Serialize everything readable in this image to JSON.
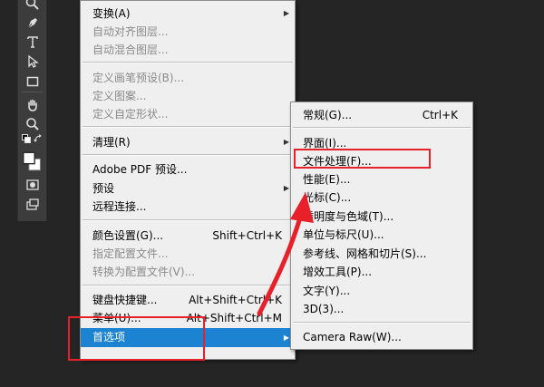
{
  "toolbar": {
    "tools": [
      "zoom-icon",
      "pen-icon",
      "type-icon",
      "path-select-icon",
      "rectangle-icon",
      "hand-icon",
      "zoom-icon",
      "default-colors-icon",
      "swap-colors-icon",
      "color-swatches",
      "quick-mask-icon",
      "screen-mode-icon"
    ]
  },
  "edit_menu": {
    "items": [
      {
        "label": "变换(A)",
        "shortcut": "",
        "submenu": true,
        "disabled": false
      },
      {
        "label": "自动对齐图层...",
        "shortcut": "",
        "submenu": false,
        "disabled": true
      },
      {
        "label": "自动混合图层...",
        "shortcut": "",
        "submenu": false,
        "disabled": true
      },
      {
        "label": "定义画笔预设(B)...",
        "shortcut": "",
        "submenu": false,
        "disabled": true
      },
      {
        "label": "定义图案...",
        "shortcut": "",
        "submenu": false,
        "disabled": true
      },
      {
        "label": "定义自定形状...",
        "shortcut": "",
        "submenu": false,
        "disabled": true
      },
      {
        "label": "清理(R)",
        "shortcut": "",
        "submenu": true,
        "disabled": false
      },
      {
        "label": "Adobe PDF 预设...",
        "shortcut": "",
        "submenu": false,
        "disabled": false
      },
      {
        "label": "预设",
        "shortcut": "",
        "submenu": true,
        "disabled": false
      },
      {
        "label": "远程连接...",
        "shortcut": "",
        "submenu": false,
        "disabled": false
      },
      {
        "label": "颜色设置(G)...",
        "shortcut": "Shift+Ctrl+K",
        "submenu": false,
        "disabled": false
      },
      {
        "label": "指定配置文件...",
        "shortcut": "",
        "submenu": false,
        "disabled": true
      },
      {
        "label": "转换为配置文件(V)...",
        "shortcut": "",
        "submenu": false,
        "disabled": true
      },
      {
        "label": "键盘快捷键...",
        "shortcut": "Alt+Shift+Ctrl+K",
        "submenu": false,
        "disabled": false
      },
      {
        "label": "菜单(U)...",
        "shortcut": "Alt+Shift+Ctrl+M",
        "submenu": false,
        "disabled": false
      },
      {
        "label": "首选项",
        "shortcut": "",
        "submenu": true,
        "disabled": false,
        "highlight": true
      }
    ]
  },
  "preferences_menu": {
    "items": [
      {
        "label": "常规(G)...",
        "shortcut": "Ctrl+K"
      },
      {
        "label": "界面(I)...",
        "shortcut": ""
      },
      {
        "label": "文件处理(F)...",
        "shortcut": ""
      },
      {
        "label": "性能(E)...",
        "shortcut": ""
      },
      {
        "label": "光标(C)...",
        "shortcut": ""
      },
      {
        "label": "透明度与色域(T)...",
        "shortcut": ""
      },
      {
        "label": "单位与标尺(U)...",
        "shortcut": ""
      },
      {
        "label": "参考线、网格和切片(S)...",
        "shortcut": ""
      },
      {
        "label": "增效工具(P)...",
        "shortcut": ""
      },
      {
        "label": "文字(Y)...",
        "shortcut": ""
      },
      {
        "label": "3D(3)...",
        "shortcut": ""
      },
      {
        "label": "Camera Raw(W)...",
        "shortcut": ""
      }
    ]
  },
  "colors": {
    "highlight": "#1c82d2",
    "annotation": "#e8202a",
    "menu_bg": "#efefef",
    "toolbar_bg": "#3c3c3c",
    "background": "#252525"
  }
}
